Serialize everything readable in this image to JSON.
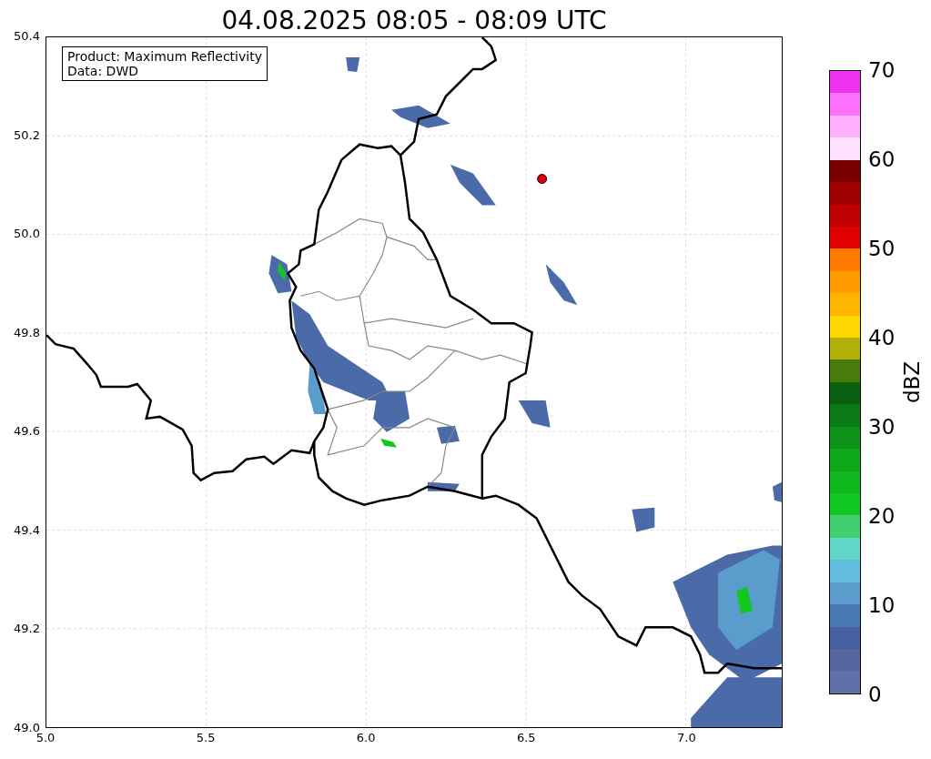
{
  "figure": {
    "title": "04.08.2025 08:05 - 08:09 UTC"
  },
  "info_box": {
    "lines": [
      "Product: Maximum Reflectivity",
      "Data: DWD"
    ]
  },
  "axes": {
    "yticks": [
      "50.4",
      "50.2",
      "50.0",
      "49.8",
      "49.6",
      "49.4",
      "49.2",
      "49.0"
    ],
    "xticks": [
      "5.0",
      "5.5",
      "6.0",
      "6.5",
      "7.0"
    ]
  },
  "colorbar": {
    "label": "dBZ",
    "ticks": [
      "70",
      "60",
      "50",
      "40",
      "30",
      "20",
      "10",
      "0"
    ],
    "bins": [
      {
        "color": "#ee33ee"
      },
      {
        "color": "#ff70ff"
      },
      {
        "color": "#ffb0ff"
      },
      {
        "color": "#ffe0ff"
      },
      {
        "color": "#780000"
      },
      {
        "color": "#a00000"
      },
      {
        "color": "#c00000"
      },
      {
        "color": "#e00000"
      },
      {
        "color": "#ff7c00"
      },
      {
        "color": "#ff9c00"
      },
      {
        "color": "#ffb400"
      },
      {
        "color": "#ffd700"
      },
      {
        "color": "#b0b008"
      },
      {
        "color": "#4a7a0a"
      },
      {
        "color": "#0a5e10"
      },
      {
        "color": "#0a7a14"
      },
      {
        "color": "#0c9218"
      },
      {
        "color": "#0ea81a"
      },
      {
        "color": "#10b820"
      },
      {
        "color": "#10c820"
      },
      {
        "color": "#40d070"
      },
      {
        "color": "#62d6c8"
      },
      {
        "color": "#62bedc"
      },
      {
        "color": "#5a9ccc"
      },
      {
        "color": "#4a78b0"
      },
      {
        "color": "#4560a0"
      },
      {
        "color": "#5566a0"
      },
      {
        "color": "#6070a8"
      }
    ]
  }
}
